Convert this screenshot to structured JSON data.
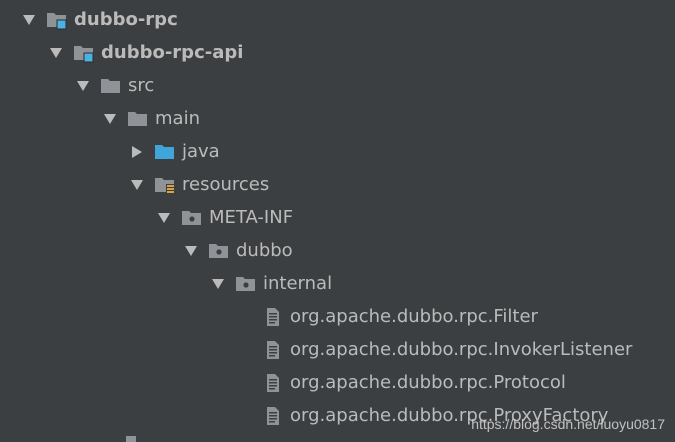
{
  "tree": {
    "rows": [
      {
        "label": "dubbo-rpc",
        "bold": true,
        "expanded": true,
        "icon": "module-folder-icon"
      },
      {
        "label": "dubbo-rpc-api",
        "bold": true,
        "expanded": true,
        "icon": "module-folder-icon"
      },
      {
        "label": "src",
        "expanded": true,
        "icon": "folder-icon"
      },
      {
        "label": "main",
        "expanded": true,
        "icon": "folder-icon"
      },
      {
        "label": "java",
        "expanded": false,
        "icon": "source-folder-icon"
      },
      {
        "label": "resources",
        "expanded": true,
        "icon": "resources-folder-icon"
      },
      {
        "label": "META-INF",
        "expanded": true,
        "icon": "package-folder-icon"
      },
      {
        "label": "dubbo",
        "expanded": true,
        "icon": "package-folder-icon"
      },
      {
        "label": "internal",
        "expanded": true,
        "icon": "package-folder-icon"
      },
      {
        "label": "org.apache.dubbo.rpc.Filter",
        "icon": "text-file-icon"
      },
      {
        "label": "org.apache.dubbo.rpc.InvokerListener",
        "icon": "text-file-icon"
      },
      {
        "label": "org.apache.dubbo.rpc.Protocol",
        "icon": "text-file-icon"
      },
      {
        "label": "org.apache.dubbo.rpc.ProxyFactory",
        "icon": "text-file-icon"
      }
    ]
  },
  "watermark": "https://blog.csdn.net/luoyu0817",
  "colors": {
    "background": "#3c3f41",
    "text": "#bbbbbb",
    "folder": "#8f9398",
    "source_folder": "#40a6d9",
    "module_badge": "#4bb2e0",
    "resources_badge": "#d9a343"
  }
}
